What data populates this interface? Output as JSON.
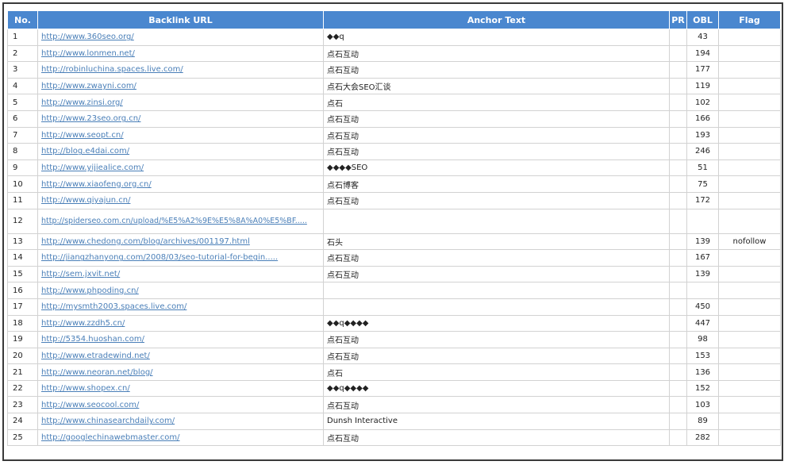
{
  "table": {
    "headers": {
      "no": "No.",
      "url": "Backlink URL",
      "anchor": "Anchor Text",
      "pr": "PR",
      "obl": "OBL",
      "flag": "Flag"
    },
    "rows": [
      {
        "no": "1",
        "url": "http://www.360seo.org/",
        "anchor": "◆◆q",
        "pr": "",
        "obl": "43",
        "flag": ""
      },
      {
        "no": "2",
        "url": "http://www.lonmen.net/",
        "anchor": "点石互动",
        "pr": "",
        "obl": "194",
        "flag": ""
      },
      {
        "no": "3",
        "url": "http://robinluchina.spaces.live.com/",
        "anchor": "点石互动",
        "pr": "",
        "obl": "177",
        "flag": ""
      },
      {
        "no": "4",
        "url": "http://www.zwayni.com/",
        "anchor": "点石大会SEO汇谈",
        "pr": "",
        "obl": "119",
        "flag": ""
      },
      {
        "no": "5",
        "url": "http://www.zinsi.org/",
        "anchor": "点石",
        "pr": "",
        "obl": "102",
        "flag": ""
      },
      {
        "no": "6",
        "url": "http://www.23seo.org.cn/",
        "anchor": "点石互动",
        "pr": "",
        "obl": "166",
        "flag": ""
      },
      {
        "no": "7",
        "url": "http://www.seopt.cn/",
        "anchor": "点石互动",
        "pr": "",
        "obl": "193",
        "flag": ""
      },
      {
        "no": "8",
        "url": "http://blog.e4dai.com/",
        "anchor": "点石互动",
        "pr": "",
        "obl": "246",
        "flag": ""
      },
      {
        "no": "9",
        "url": "http://www.yijiealice.com/",
        "anchor": "◆◆◆◆SEO",
        "pr": "",
        "obl": "51",
        "flag": ""
      },
      {
        "no": "10",
        "url": "http://www.xiaofeng.org.cn/",
        "anchor": "点石博客",
        "pr": "",
        "obl": "75",
        "flag": ""
      },
      {
        "no": "11",
        "url": "http://www.qiyajun.cn/",
        "anchor": "点石互动",
        "pr": "",
        "obl": "172",
        "flag": ""
      },
      {
        "no": "12",
        "url": "http://spiderseo.com.cn/upload/%E5%A2%9E%E5%8A%A0%E5%BF.....",
        "anchor": "",
        "pr": "",
        "obl": "",
        "flag": ""
      },
      {
        "no": "13",
        "url": "http://www.chedong.com/blog/archives/001197.html",
        "anchor": "石头",
        "pr": "",
        "obl": "139",
        "flag": "nofollow"
      },
      {
        "no": "14",
        "url": "http://jiangzhanyong.com/2008/03/seo-tutorial-for-begin.....",
        "anchor": "点石互动",
        "pr": "",
        "obl": "167",
        "flag": ""
      },
      {
        "no": "15",
        "url": "http://sem.jxvit.net/",
        "anchor": "点石互动",
        "pr": "",
        "obl": "139",
        "flag": ""
      },
      {
        "no": "16",
        "url": "http://www.phpoding.cn/",
        "anchor": "",
        "pr": "",
        "obl": "",
        "flag": ""
      },
      {
        "no": "17",
        "url": "http://mysmth2003.spaces.live.com/",
        "anchor": "",
        "pr": "",
        "obl": "450",
        "flag": ""
      },
      {
        "no": "18",
        "url": "http://www.zzdh5.cn/",
        "anchor": "◆◆q◆◆◆◆",
        "pr": "",
        "obl": "447",
        "flag": ""
      },
      {
        "no": "19",
        "url": "http://5354.huoshan.com/",
        "anchor": "点石互动",
        "pr": "",
        "obl": "98",
        "flag": ""
      },
      {
        "no": "20",
        "url": "http://www.etradewind.net/",
        "anchor": "点石互动",
        "pr": "",
        "obl": "153",
        "flag": ""
      },
      {
        "no": "21",
        "url": "http://www.neoran.net/blog/",
        "anchor": "点石",
        "pr": "",
        "obl": "136",
        "flag": ""
      },
      {
        "no": "22",
        "url": "http://www.shopex.cn/",
        "anchor": "◆◆q◆◆◆◆",
        "pr": "",
        "obl": "152",
        "flag": ""
      },
      {
        "no": "23",
        "url": "http://www.seocool.com/",
        "anchor": "点石互动",
        "pr": "",
        "obl": "103",
        "flag": ""
      },
      {
        "no": "24",
        "url": "http://www.chinasearchdaily.com/",
        "anchor": "Dunsh Interactive",
        "pr": "",
        "obl": "89",
        "flag": ""
      },
      {
        "no": "25",
        "url": "http://googlechinawebmaster.com/",
        "anchor": "点石互动",
        "pr": "",
        "obl": "282",
        "flag": ""
      }
    ]
  }
}
